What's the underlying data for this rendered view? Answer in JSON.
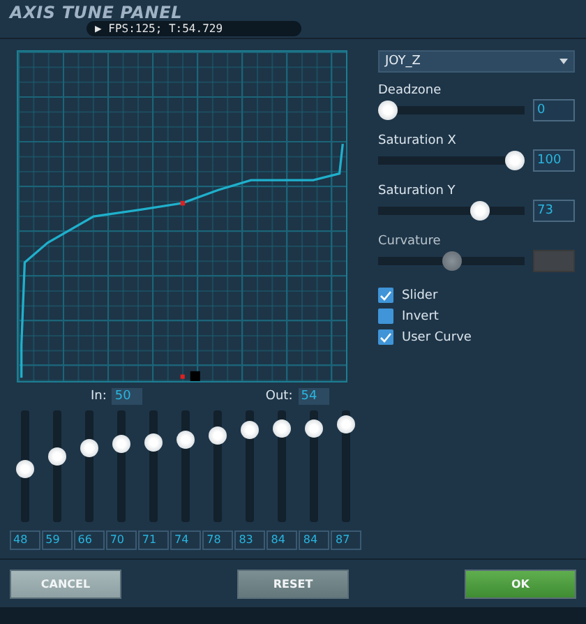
{
  "window": {
    "title": "AXIS TUNE PANEL"
  },
  "overlay": {
    "text": "▶ FPS:125; T:54.729"
  },
  "axis_select": {
    "value": "JOY_Z"
  },
  "settings": [
    {
      "label": "Deadzone",
      "level": 0,
      "value": "0",
      "disabled": false
    },
    {
      "label": "Saturation X",
      "level": 1,
      "value": "100",
      "disabled": false
    },
    {
      "label": "Saturation Y",
      "level": 0.73,
      "value": "73",
      "disabled": false
    },
    {
      "label": "Curvature",
      "level": 0.5,
      "disabled": true
    }
  ],
  "options": [
    {
      "label": "Slider",
      "checked": true
    },
    {
      "label": "Invert",
      "checked": false
    },
    {
      "label": "User Curve",
      "checked": true
    }
  ],
  "in_out": {
    "in_label": "In:",
    "in_value": "50",
    "out_label": "Out:",
    "out_value": "54"
  },
  "curve_points": [
    {
      "level": 0.48,
      "value": "48"
    },
    {
      "level": 0.59,
      "value": "59"
    },
    {
      "level": 0.66,
      "value": "66"
    },
    {
      "level": 0.7,
      "value": "70"
    },
    {
      "level": 0.71,
      "value": "71"
    },
    {
      "level": 0.74,
      "value": "74"
    },
    {
      "level": 0.78,
      "value": "78"
    },
    {
      "level": 0.83,
      "value": "83"
    },
    {
      "level": 0.84,
      "value": "84"
    },
    {
      "level": 0.84,
      "value": "84"
    },
    {
      "level": 0.87,
      "value": "87"
    }
  ],
  "buttons": [
    {
      "label": "CANCEL",
      "kind": "grey"
    },
    {
      "label": "RESET",
      "kind": "dark"
    },
    {
      "label": "OK",
      "kind": "green"
    }
  ]
}
